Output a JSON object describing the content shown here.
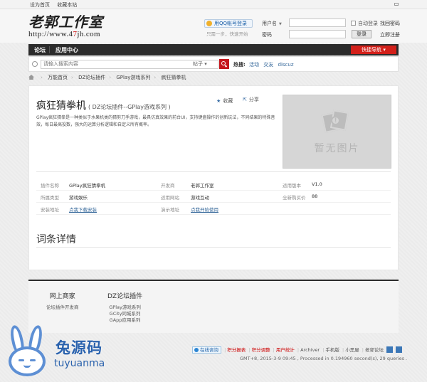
{
  "topbar": {
    "set_home": "设为首页",
    "add_favorite": "收藏本站"
  },
  "logo": {
    "name": "老郭工作室",
    "url_prefix": "http://www.4",
    "url_red": "7",
    "url_suffix": "jh.com"
  },
  "qq": {
    "login_label": "用QQ帐号登录",
    "sub_text": "只需一步，快速开始"
  },
  "login": {
    "username_label": "用户名",
    "password_label": "密码",
    "remember_label": "自动登录",
    "login_button": "登录",
    "forgot_link": "找回密码",
    "register_link": "立即注册"
  },
  "nav": {
    "items": [
      "论坛",
      "应用中心"
    ],
    "quick_nav": "快捷导航"
  },
  "search": {
    "placeholder": "请输入搜索内容",
    "type": "帖子",
    "hot_label": "热搜:",
    "hot_items": [
      "活动",
      "交友",
      "discuz"
    ]
  },
  "breadcrumb": [
    "万能首页",
    "DZ论坛插件",
    "GPlay游戏系列",
    "疯狂猜拳机"
  ],
  "plugin": {
    "title": "疯狂猜拳机",
    "subtitle": "( DZ论坛插件--GPlay游戏系列 )",
    "favorite": "收藏",
    "share": "分享",
    "description": "GPlay疯狂猜拳是一种类似于水果机类的猜剪刀手游戏，最具仿真效果的前台UI，支持键盘操作的创新玩法，不同结果的特殊音效，每日最高投数，强大的运算分析逻辑和自定义所有概率。",
    "no_image": "暂无图片"
  },
  "specs": [
    [
      {
        "k": "插件名称",
        "v": "GPlay疯狂猜拳机"
      },
      {
        "k": "开发商",
        "v": "老郭工作室"
      },
      {
        "k": "适用版本",
        "v": "V1.0"
      }
    ],
    [
      {
        "k": "所属类型",
        "v": "游戏娱乐"
      },
      {
        "k": "适用网站",
        "v": "游戏互动"
      },
      {
        "k": "全新购买价",
        "v": "88"
      }
    ],
    [
      {
        "k": "安装地址",
        "v": "点我下载安装"
      },
      {
        "k": "演示地址",
        "v": "点我开始使用"
      }
    ]
  ],
  "detail_title": "词条详情",
  "footer": {
    "col1": {
      "title": "网上商家",
      "items": [
        "论坛插件开发商"
      ]
    },
    "col2": {
      "title": "DZ论坛插件",
      "items": [
        "GPlay游戏系列",
        "GCity同城系列",
        "GApp应用系列"
      ]
    },
    "online": "在线咨询",
    "links_red": [
      "积分报表",
      "积分调整",
      "用户统计"
    ],
    "links": [
      "Archiver",
      "手机版",
      "小黑屋",
      "老郭论坛"
    ],
    "timestamp": "GMT+8, 2015-3-9 09:45 , Processed in 0.194960 second(s), 29 queries ."
  },
  "watermark": {
    "cn": "兔源码",
    "en": "tuyuanma"
  },
  "colors": {
    "accent_red": "#d3201a",
    "nav_dark": "#2b2b2b",
    "link_blue": "#336699"
  }
}
